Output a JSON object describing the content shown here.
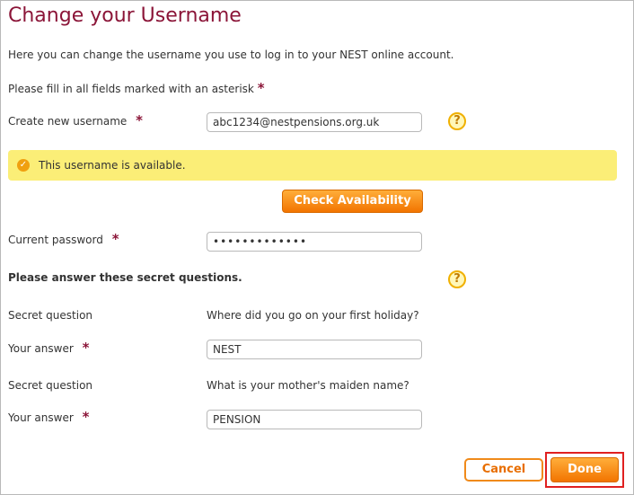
{
  "page": {
    "title": "Change your Username",
    "intro": "Here you can change the username you use to log in to your NEST online account.",
    "required_note": "Please fill in all fields marked with an asterisk",
    "asterisk": "*"
  },
  "username": {
    "label": "Create new username",
    "value": "abc1234@nestpensions.org.uk",
    "help_icon": "question-help-icon",
    "help_glyph": "?"
  },
  "availability": {
    "message": "This username is available.",
    "icon": "checkmark-icon",
    "check_label": "Check Availability"
  },
  "password": {
    "label": "Current password",
    "value": "•••••••••••••"
  },
  "secret": {
    "heading": "Please answer these secret questions.",
    "help_glyph": "?",
    "questions": [
      {
        "question_label": "Secret question",
        "question": "Where did you go on your first holiday?",
        "answer_label": "Your answer",
        "answer": "NEST"
      },
      {
        "question_label": "Secret question",
        "question": "What is your mother's maiden name?",
        "answer_label": "Your answer",
        "answer": "PENSION"
      }
    ]
  },
  "actions": {
    "cancel_label": "Cancel",
    "done_label": "Done"
  },
  "colors": {
    "title": "#8b1538",
    "accent_orange": "#f27400",
    "available_bar": "#fbee77",
    "highlight": "#e02020"
  }
}
